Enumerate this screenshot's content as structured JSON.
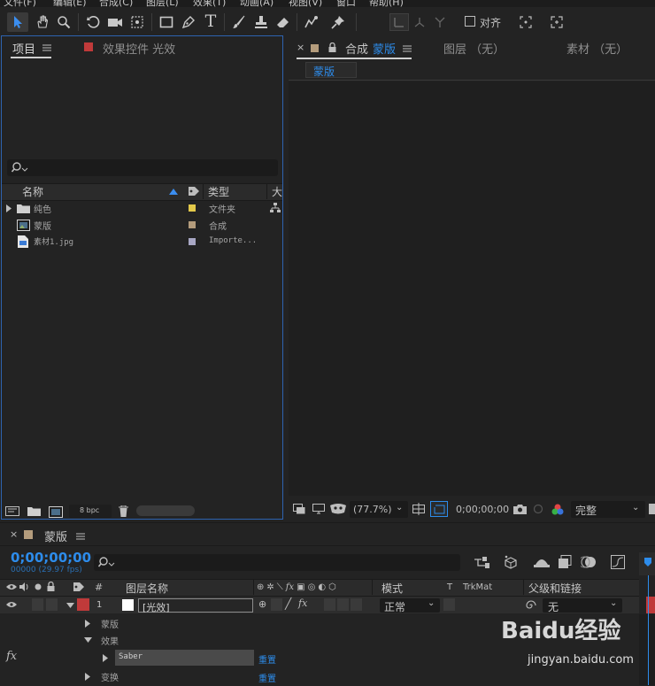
{
  "menu": [
    "文件(F)",
    "编辑(E)",
    "合成(C)",
    "图层(L)",
    "效果(T)",
    "动画(A)",
    "视图(V)",
    "窗口",
    "帮助(H)"
  ],
  "toolbar": {
    "snap_label": "对齐"
  },
  "project": {
    "tab_project": "项目",
    "tab_effects": "效果控件 光效",
    "columns": {
      "name": "名称",
      "type": "类型",
      "size": "大"
    },
    "items": [
      {
        "name": "纯色",
        "type": "文件夹",
        "label_color": "#e3c94a"
      },
      {
        "name": "蒙版",
        "type": "合成",
        "label_color": "#b49c7c"
      },
      {
        "name": "素材1.jpg",
        "type": "Importe...",
        "label_color": "#a8a7c4"
      }
    ],
    "bpc": "8 bpc"
  },
  "comp": {
    "tab_prefix": "合成",
    "tab_name": "蒙版",
    "tab_layer": "图层 （无）",
    "tab_footage": "素材 （无）",
    "sub_tab": "蒙版",
    "zoom": "(77.7%)",
    "timecode": "0;00;00;00",
    "quality": "完整"
  },
  "timeline": {
    "tab_name": "蒙版",
    "timecode": "0;00;00;00",
    "frame_info": "00000 (29.97 fps)",
    "headers": {
      "number": "#",
      "layer_name": "图层名称",
      "mode": "模式",
      "t": "T",
      "trkmat": "TrkMat",
      "parent": "父级和链接"
    },
    "layer": {
      "number": "1",
      "name": "[光效]",
      "mode": "正常",
      "parent": "无"
    },
    "sub_rows": {
      "masks": "蒙版",
      "effects": "效果",
      "effect_name": "Saber",
      "transform": "变换",
      "reset": "重置"
    }
  },
  "watermark": {
    "text": "Baidu经验",
    "url": "jingyan.baidu.com"
  }
}
